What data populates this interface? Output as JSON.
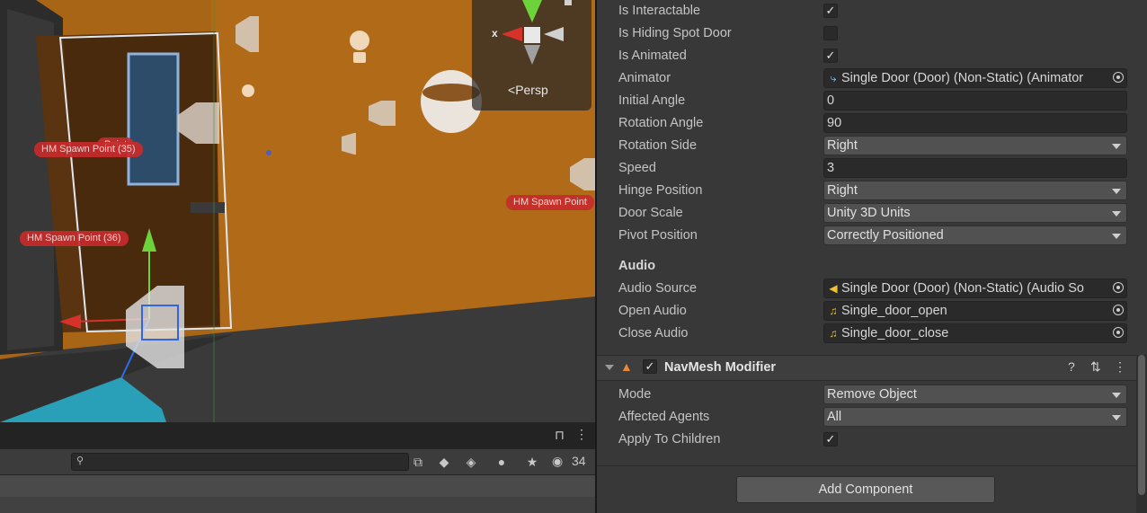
{
  "scene": {
    "gizmo_persp_label": "Persp",
    "gizmo_x_label": "x",
    "spawn_labels": [
      "HM Spawn Point (35)",
      "HM Spawn Point (36)",
      "HM Spawn Point",
      "Point"
    ]
  },
  "project_bar": {
    "hidden_count": "34"
  },
  "inspector": {
    "rows": [
      {
        "label": "Is Interactable",
        "kind": "check",
        "value": "✓"
      },
      {
        "label": "Is Hiding Spot Door",
        "kind": "check",
        "value": ""
      },
      {
        "label": "Is Animated",
        "kind": "check",
        "value": "✓"
      },
      {
        "label": "Animator",
        "kind": "object",
        "value": "Single Door (Door) (Non-Static) (Animator"
      },
      {
        "label": "Initial Angle",
        "kind": "number",
        "value": "0"
      },
      {
        "label": "Rotation Angle",
        "kind": "number",
        "value": "90"
      },
      {
        "label": "Rotation Side",
        "kind": "dropdown",
        "value": "Right"
      },
      {
        "label": "Speed",
        "kind": "number",
        "value": "3"
      },
      {
        "label": "Hinge Position",
        "kind": "dropdown",
        "value": "Right"
      },
      {
        "label": "Door Scale",
        "kind": "dropdown",
        "value": "Unity 3D Units"
      },
      {
        "label": "Pivot Position",
        "kind": "dropdown",
        "value": "Correctly Positioned"
      }
    ],
    "audio": {
      "title": "Audio",
      "audio_source_label": "Audio Source",
      "audio_source_value": "Single Door (Door) (Non-Static) (Audio So",
      "open_audio_label": "Open Audio",
      "open_audio_value": "Single_door_open",
      "close_audio_label": "Close Audio",
      "close_audio_value": "Single_door_close"
    },
    "navmesh": {
      "title": "NavMesh Modifier",
      "mode_label": "Mode",
      "mode_value": "Remove Object",
      "agents_label": "Affected Agents",
      "agents_value": "All",
      "apply_label": "Apply To Children",
      "apply_value": "✓"
    },
    "add_component": "Add Component"
  }
}
